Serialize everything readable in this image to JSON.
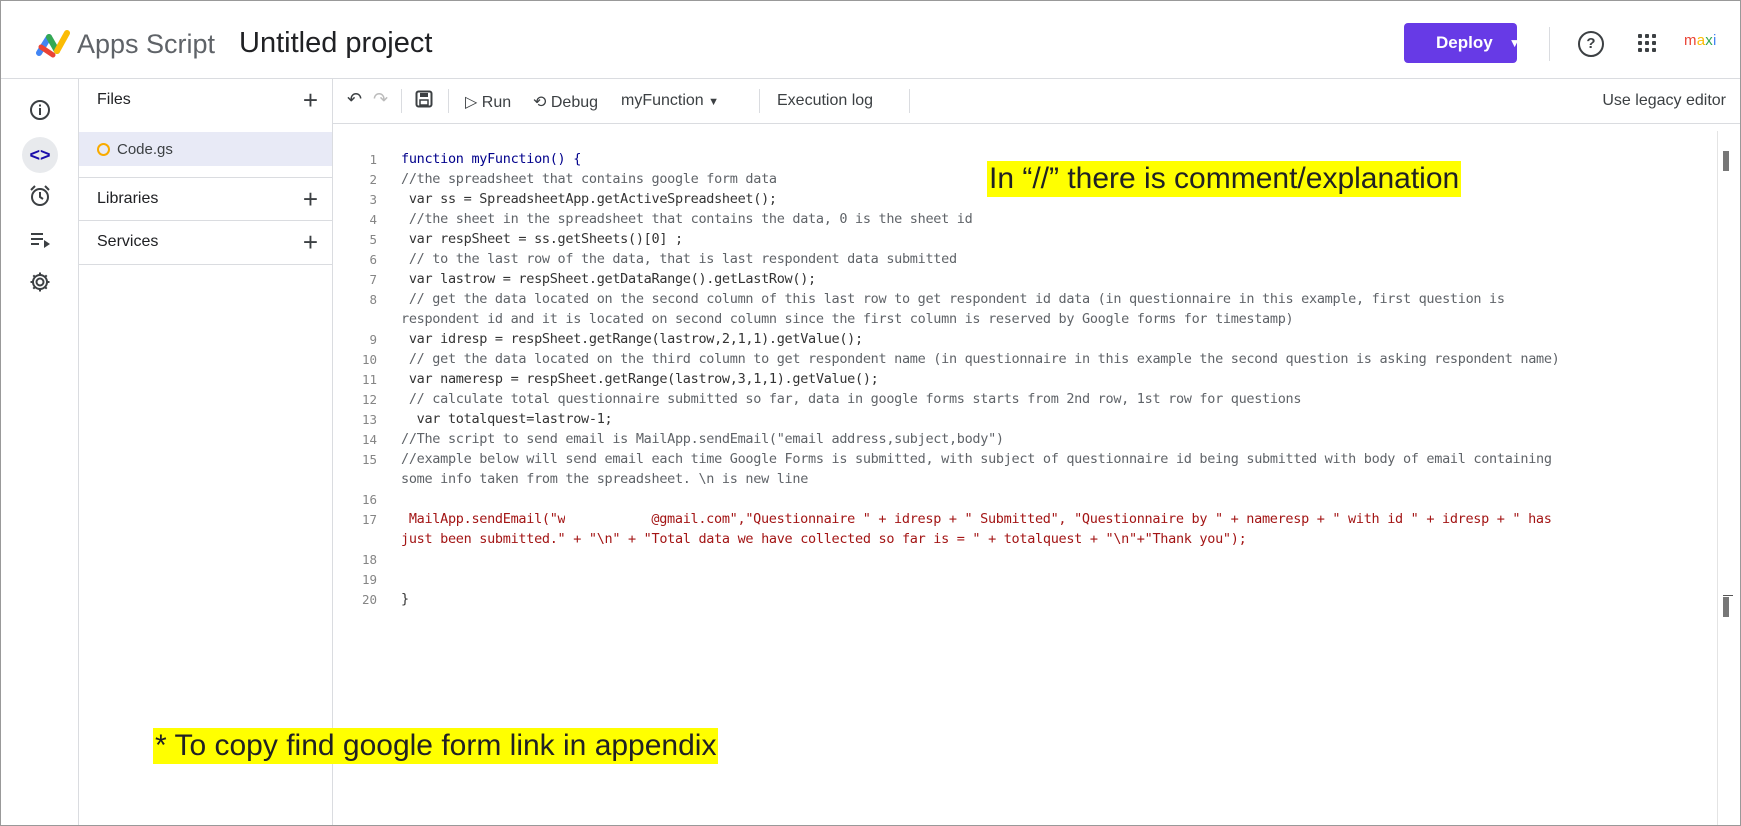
{
  "header": {
    "app_name": "Apps Script",
    "project_name": "Untitled project",
    "deploy_label": "Deploy",
    "user_label": "maxi",
    "help_icon": "help-icon",
    "apps_icon": "apps-grid-icon"
  },
  "rail": {
    "items": [
      "info-icon",
      "code-icon",
      "triggers-icon",
      "executions-icon",
      "settings-icon"
    ],
    "active": "code-icon"
  },
  "files_panel": {
    "files_label": "Files",
    "file_name": "Code.gs",
    "libraries_label": "Libraries",
    "services_label": "Services"
  },
  "toolbar": {
    "run_label": "Run",
    "debug_label": "Debug",
    "function_label": "myFunction",
    "log_label": "Execution log",
    "legacy_label": "Use legacy editor"
  },
  "code": {
    "line_numbers": [
      "1",
      "2",
      "3",
      "4",
      "5",
      "6",
      "7",
      "8",
      "9",
      "10",
      "11",
      "12",
      "13",
      "14",
      "15",
      "16",
      "17",
      "18",
      "19",
      "20"
    ],
    "lines": [
      "function myFunction() {",
      "//the spreadsheet that contains google form data",
      " var ss = SpreadsheetApp.getActiveSpreadsheet();",
      " //the sheet in the spreadsheet that contains the data, 0 is the sheet id",
      " var respSheet = ss.getSheets()[0] ;",
      " // to the last row of the data, that is last respondent data submitted",
      " var lastrow = respSheet.getDataRange().getLastRow();",
      " // get the data located on the second column of this last row to get respondent id data (in questionnaire in this example, first question is",
      "respondent id and it is located on second column since the first column is reserved by Google forms for timestamp)",
      " var idresp = respSheet.getRange(lastrow,2,1,1).getValue();",
      " // get the data located on the third column to get respondent name (in questionnaire in this example the second question is asking respondent name)",
      " var nameresp = respSheet.getRange(lastrow,3,1,1).getValue();",
      " // calculate total questionnaire submitted so far, data in google forms starts from 2nd row, 1st row for questions",
      "  var totalquest=lastrow-1;",
      "//The script to send email is MailApp.sendEmail(\"email address,subject,body\")",
      "//example below will send email each time Google Forms is submitted, with subject of questionnaire id being submitted with body of email containing",
      "some info taken from the spreadsheet. \\n is new line",
      " MailApp.sendEmail(\"w",
      "@gmail.com\",\"Questionnaire \" + idresp + \" Submitted\", \"Questionnaire by \" + nameresp + \" with id \" + idresp + \" has",
      "just been submitted.\" + \"\\n\" + \"Total data we have collected so far is = \" + totalquest + \"\\n\"+\"Thank you\");",
      "}"
    ]
  },
  "annotations": {
    "comment_note": "In “//” there is comment/explanation",
    "appendix_note": "* To copy find google form link in appendix"
  },
  "colors": {
    "deploy_bg": "#673ae6",
    "highlight": "#ffff00",
    "active_file_bg": "#e8eaf6"
  }
}
